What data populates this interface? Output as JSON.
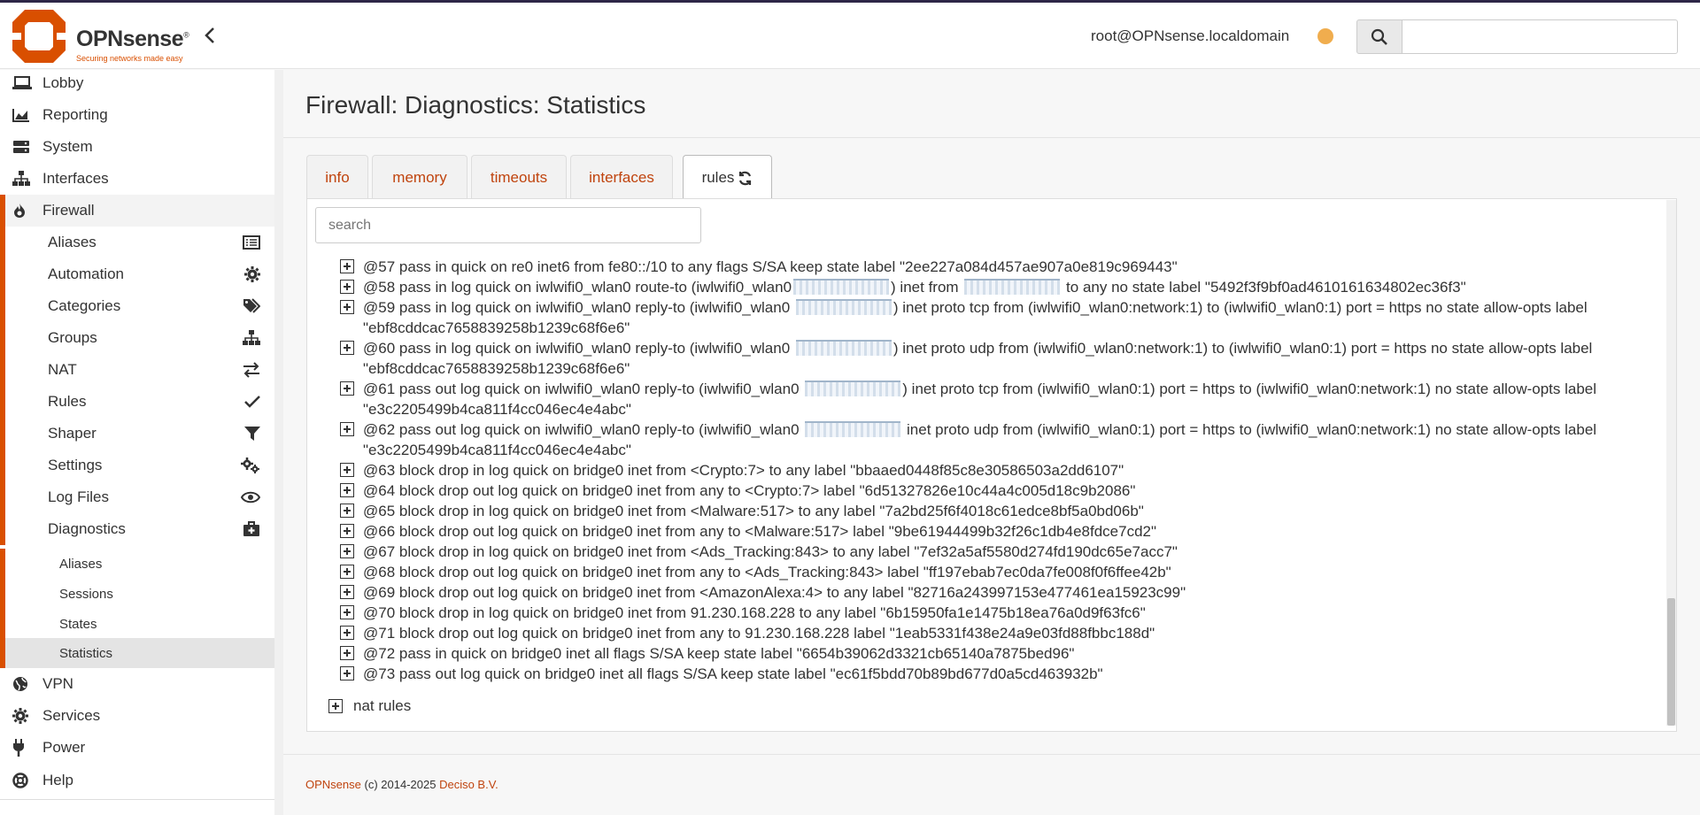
{
  "brand": {
    "name": "OPNsense",
    "reg": "®",
    "tagline": "Securing networks made easy"
  },
  "header": {
    "user": "root@OPNsense.localdomain",
    "status_color": "#f0ad4e",
    "search_placeholder": ""
  },
  "sidebar": {
    "items": [
      {
        "label": "Lobby",
        "icon": "laptop-icon"
      },
      {
        "label": "Reporting",
        "icon": "area-chart-icon"
      },
      {
        "label": "System",
        "icon": "server-icon"
      },
      {
        "label": "Interfaces",
        "icon": "sitemap-icon"
      },
      {
        "label": "Firewall",
        "icon": "fire-icon"
      }
    ],
    "firewall_sub": [
      {
        "label": "Aliases",
        "icon": "list-icon"
      },
      {
        "label": "Automation",
        "icon": "gear-icon"
      },
      {
        "label": "Categories",
        "icon": "tags-icon"
      },
      {
        "label": "Groups",
        "icon": "sitemap-icon"
      },
      {
        "label": "NAT",
        "icon": "exchange-icon"
      },
      {
        "label": "Rules",
        "icon": "check-icon"
      },
      {
        "label": "Shaper",
        "icon": "filter-icon"
      },
      {
        "label": "Settings",
        "icon": "gears-icon"
      },
      {
        "label": "Log Files",
        "icon": "eye-icon"
      },
      {
        "label": "Diagnostics",
        "icon": "medkit-icon"
      }
    ],
    "diagnostics_sub": [
      "Aliases",
      "Sessions",
      "States",
      "Statistics"
    ],
    "bottom_items": [
      {
        "label": "VPN",
        "icon": "globe-icon"
      },
      {
        "label": "Services",
        "icon": "gear-icon"
      },
      {
        "label": "Power",
        "icon": "plug-icon"
      },
      {
        "label": "Help",
        "icon": "life-ring-icon"
      }
    ]
  },
  "main": {
    "title": "Firewall: Diagnostics: Statistics",
    "tabs": [
      "info",
      "memory",
      "timeouts",
      "interfaces",
      "rules"
    ],
    "active_tab": "rules",
    "search_placeholder": "search",
    "rules": [
      {
        "a": "@57 pass in quick on re0 inet6 from fe80::/10 to any flags S/SA keep state label \"2ee227a084d457ae907a0e819c969443\""
      },
      {
        "a": "@58 pass in log quick on iwlwifi0_wlan0 route-to (iwlwifi0_wlan0",
        "b": ") inet from",
        "c": "to any no state label \"5492f3f9bf0ad4610161634802ec36f3\""
      },
      {
        "a": "@59 pass in log quick on iwlwifi0_wlan0 reply-to (iwlwifi0_wlan0",
        "b": ") inet proto tcp from (iwlwifi0_wlan0:network:1) to (iwlwifi0_wlan0:1) port = https no state allow-opts label \"ebf8cddcac7658839258b1239c68f6e6\""
      },
      {
        "a": "@60 pass in log quick on iwlwifi0_wlan0 reply-to (iwlwifi0_wlan0",
        "b": ") inet proto udp from (iwlwifi0_wlan0:network:1) to (iwlwifi0_wlan0:1) port = https no state allow-opts label \"ebf8cddcac7658839258b1239c68f6e6\""
      },
      {
        "a": "@61 pass out log quick on iwlwifi0_wlan0 reply-to (iwlwifi0_wlan0",
        "b": ") inet proto tcp from (iwlwifi0_wlan0:1) port = https to (iwlwifi0_wlan0:network:1) no state allow-opts label \"e3c2205499b4ca811f4cc046ec4e4abc\""
      },
      {
        "a": "@62 pass out log quick on iwlwifi0_wlan0 reply-to (iwlwifi0_wlan0",
        "b": "inet proto udp from (iwlwifi0_wlan0:1) port = https to (iwlwifi0_wlan0:network:1) no state allow-opts label \"e3c2205499b4ca811f4cc046ec4e4abc\""
      },
      {
        "a": "@63 block drop in log quick on bridge0 inet from <Crypto:7> to any label \"bbaaed0448f85c8e30586503a2dd6107\""
      },
      {
        "a": "@64 block drop out log quick on bridge0 inet from any to <Crypto:7> label \"6d51327826e10c44a4c005d18c9b2086\""
      },
      {
        "a": "@65 block drop in log quick on bridge0 inet from <Malware:517> to any label \"7a2bd25f6f4018c61edce8bf5a0bd06b\""
      },
      {
        "a": "@66 block drop out log quick on bridge0 inet from any to <Malware:517> label \"9be61944499b32f26c1db4e8fdce7cd2\""
      },
      {
        "a": "@67 block drop in log quick on bridge0 inet from <Ads_Tracking:843> to any label \"7ef32a5af5580d274fd190dc65e7acc7\""
      },
      {
        "a": "@68 block drop out log quick on bridge0 inet from any to <Ads_Tracking:843> label \"ff197ebab7ec0da7fe008f0f6ffee42b\""
      },
      {
        "a": "@69 block drop out log quick on bridge0 inet from <AmazonAlexa:4> to any label \"82716a243997153e477461ea15923c99\""
      },
      {
        "a": "@70 block drop in log quick on bridge0 inet from 91.230.168.228 to any label \"6b15950fa1e1475b18ea76a0d9f63fc6\""
      },
      {
        "a": "@71 block drop out log quick on bridge0 inet from any to 91.230.168.228 label \"1eab5331f438e24a9e03fd88fbbc188d\""
      },
      {
        "a": "@72 pass in quick on bridge0 inet all flags S/SA keep state label \"6654b39062d3321cb65140a7875bed96\""
      },
      {
        "a": "@73 pass out log quick on bridge0 inet all flags S/SA keep state label \"ec61f5bdd70b89bd677d0a5cd463932b\""
      }
    ],
    "nat_label": "nat rules"
  },
  "footer": {
    "brand": "OPNsense",
    "copyright": "(c) 2014-2025",
    "company": "Deciso B.V."
  },
  "colors": {
    "accent": "#d94f00",
    "link": "#c0440e"
  }
}
